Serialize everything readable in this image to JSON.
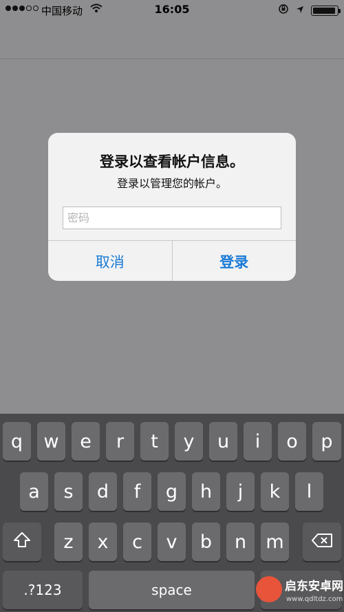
{
  "status_bar": {
    "carrier": "中国移动",
    "time": "16:05",
    "battery_level": 0.95
  },
  "alert": {
    "title": "登录以查看帐户信息。",
    "message": "登录以管理您的帐户。",
    "password_placeholder": "密码",
    "cancel_label": "取消",
    "login_label": "登录"
  },
  "keyboard": {
    "row1": [
      "q",
      "w",
      "e",
      "r",
      "t",
      "y",
      "u",
      "i",
      "o",
      "p"
    ],
    "row2": [
      "a",
      "s",
      "d",
      "f",
      "g",
      "h",
      "j",
      "k",
      "l"
    ],
    "row3": [
      "z",
      "x",
      "c",
      "v",
      "b",
      "n",
      "m"
    ],
    "numbers_label": ".?123",
    "space_label": "space",
    "shift_icon": "shift-icon",
    "delete_icon": "backspace-icon"
  },
  "watermark": {
    "title": "启东安卓网",
    "url": "www.qdltdz.com"
  }
}
